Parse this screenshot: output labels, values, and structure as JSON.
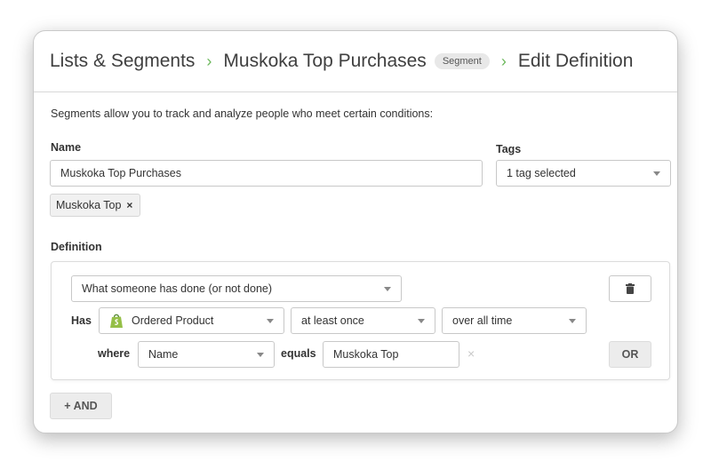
{
  "breadcrumb": {
    "lists": "Lists & Segments",
    "segment_name": "Muskoka Top Purchases",
    "badge": "Segment",
    "current": "Edit Definition",
    "separator": "›"
  },
  "intro": "Segments allow you to track and analyze people who meet certain conditions:",
  "name_field": {
    "label": "Name",
    "value": "Muskoka Top Purchases"
  },
  "tags_field": {
    "label": "Tags",
    "value": "1 tag selected"
  },
  "tag_chip": {
    "label": "Muskoka Top",
    "remove": "×"
  },
  "definition": {
    "label": "Definition",
    "condition_type": "What someone has done (or not done)",
    "has_label": "Has",
    "metric": "Ordered Product",
    "frequency": "at least once",
    "timeframe": "over all time",
    "where_label": "where",
    "property": "Name",
    "operator_label": "equals",
    "property_value": "Muskoka Top",
    "clear": "×",
    "or_button": "OR"
  },
  "and_button": "+ AND",
  "colors": {
    "accent_green": "#6cb85c",
    "shopify_green": "#95bf47"
  }
}
